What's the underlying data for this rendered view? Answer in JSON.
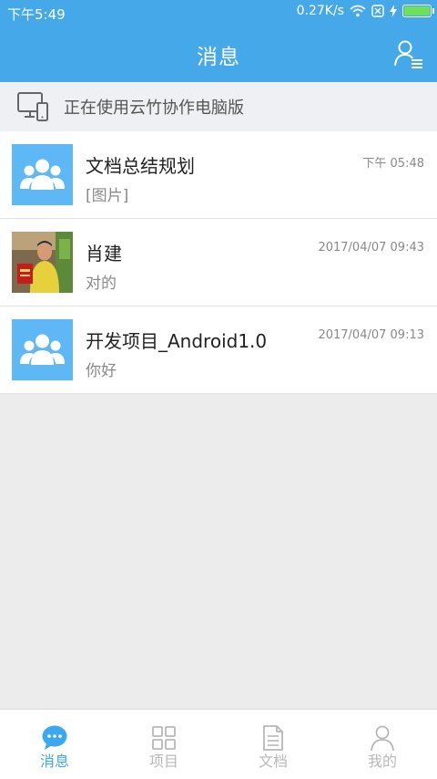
{
  "status_bar": {
    "time": "下午5:49",
    "network_speed": "0.27K/s",
    "battery_level": 1.0
  },
  "header": {
    "title": "消息",
    "contacts_icon": "contacts-list-icon"
  },
  "banner": {
    "icon": "desktop-computer-icon",
    "text": "正在使用云竹协作电脑版"
  },
  "conversations": [
    {
      "name": "文档总结规划",
      "preview": "[图片]",
      "time": "下午 05:48",
      "avatar": "group-icon"
    },
    {
      "name": "肖建",
      "preview": "对的",
      "time": "2017/04/07 09:43",
      "avatar": "user-photo"
    },
    {
      "name": "开发项目_Android1.0",
      "preview": "你好",
      "time": "2017/04/07 09:13",
      "avatar": "group-icon"
    }
  ],
  "bottom_nav": [
    {
      "label": "消息",
      "icon": "chat-bubble-icon",
      "active": true
    },
    {
      "label": "项目",
      "icon": "grid-icon",
      "active": false
    },
    {
      "label": "文档",
      "icon": "document-icon",
      "active": false
    },
    {
      "label": "我的",
      "icon": "person-icon",
      "active": false
    }
  ],
  "colors": {
    "primary": "#45a8e8",
    "active_tab": "#3ea8ec",
    "inactive_tab": "#b8b8b8",
    "avatar_group_bg": "#5fb8f6"
  }
}
